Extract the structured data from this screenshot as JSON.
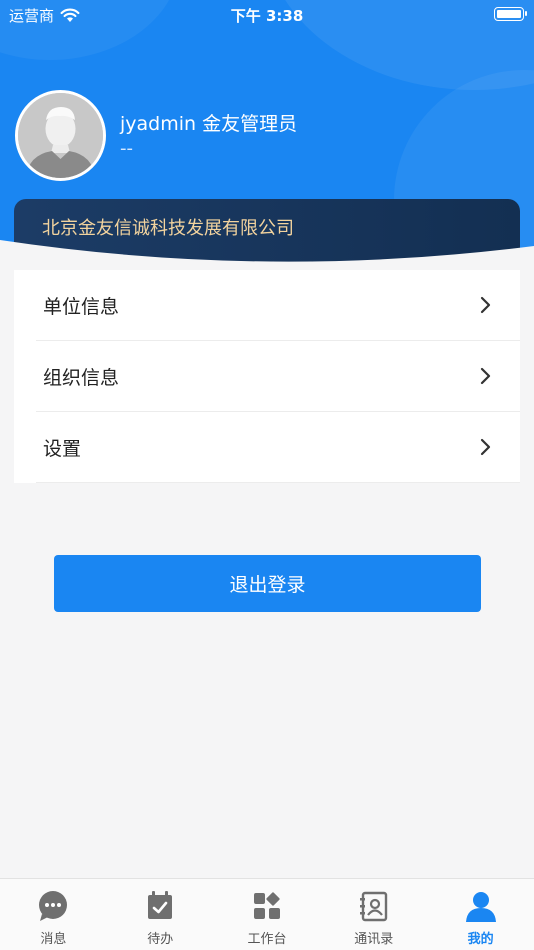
{
  "status_bar": {
    "carrier": "运营商",
    "time": "下午 3:38"
  },
  "profile": {
    "name": "jyadmin 金友管理员",
    "sub": "--"
  },
  "company": {
    "name": "北京金友信诚科技发展有限公司"
  },
  "menu": [
    {
      "label": "单位信息"
    },
    {
      "label": "组织信息"
    },
    {
      "label": "设置"
    }
  ],
  "logout_label": "退出登录",
  "tabs": [
    {
      "label": "消息",
      "icon": "message-icon"
    },
    {
      "label": "待办",
      "icon": "todo-icon"
    },
    {
      "label": "工作台",
      "icon": "workbench-icon"
    },
    {
      "label": "通讯录",
      "icon": "contacts-icon"
    },
    {
      "label": "我的",
      "icon": "profile-icon",
      "active": true
    }
  ],
  "colors": {
    "primary": "#1a86f2",
    "card": "#1c3c66",
    "card_text": "#f2d39e",
    "inactive_icon": "#6f6f6f"
  }
}
